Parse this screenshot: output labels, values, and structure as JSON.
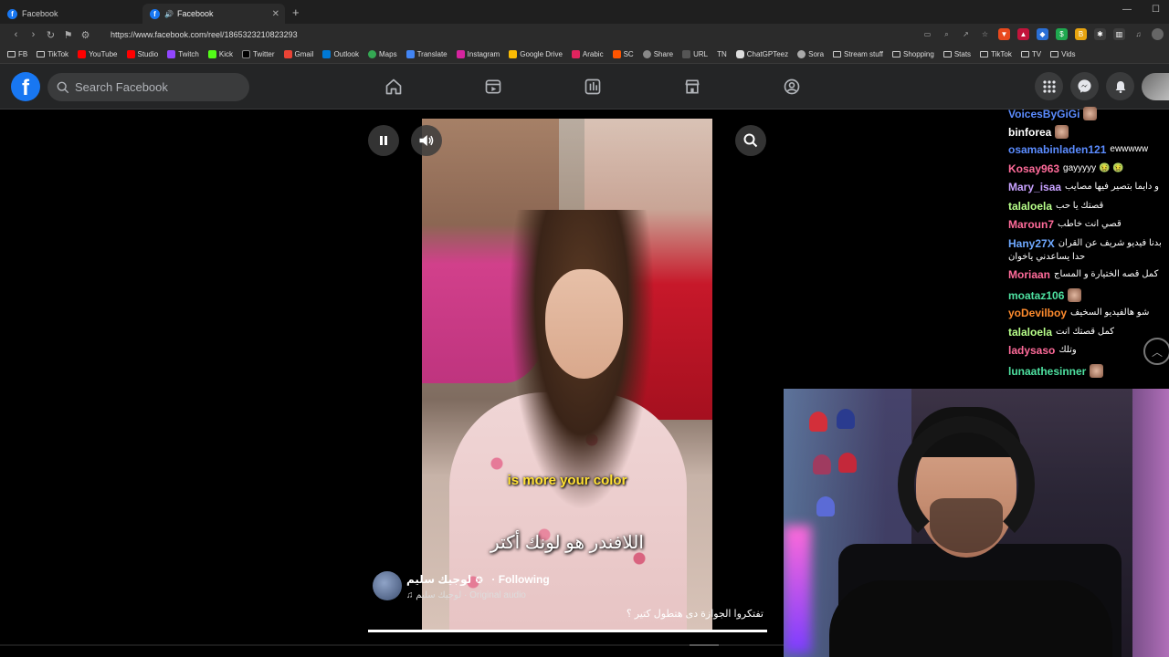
{
  "browser": {
    "tabs": [
      {
        "title": "Facebook",
        "active": false
      },
      {
        "title": "Facebook",
        "active": true
      }
    ],
    "url": "https://www.facebook.com/reel/1865323210823293",
    "bookmarks": [
      "FB",
      "TikTok",
      "YouTube",
      "Studio",
      "Twitch",
      "Kick",
      "Twitter",
      "Gmail",
      "Outlook",
      "Maps",
      "Translate",
      "Instagram",
      "Google Drive",
      "Arabic",
      "SC",
      "Share",
      "URL",
      "TN",
      "ChatGPTeez",
      "Sora",
      "Stream stuff",
      "Shopping",
      "Stats",
      "TikTok",
      "TV",
      "Vids"
    ]
  },
  "facebook": {
    "logo": "f",
    "search_placeholder": "Search Facebook"
  },
  "reel": {
    "subtitle_en": "is more your color",
    "subtitle_ar": "اللافندر هو لونك أكتر",
    "creator_name": "لوجيك سليم",
    "following_label": "· Following",
    "audio": "لوجيك سليم · Original audio",
    "caption": "تفتكروا الجوازة دى هتطول كتير ؟",
    "progress": 1.0
  },
  "chat": [
    {
      "user": "VoicesByGiGi",
      "color": "#5b8cff",
      "text": ""
    },
    {
      "user": "binforea",
      "color": "#ffffff",
      "text": ""
    },
    {
      "user": "osamabinladen121",
      "color": "#5b8cff",
      "text": "ewwwww"
    },
    {
      "user": "Kosay963",
      "color": "#ff6b9a",
      "text": "gayyyyy 🤢 🤢"
    },
    {
      "user": "Mary_isaa",
      "color": "#c8a2ff",
      "text": "و دايما بتصير فيها مصايب"
    },
    {
      "user": "talaloela",
      "color": "#b8ff8a",
      "text": "قصتك يا حب"
    },
    {
      "user": "Maroun7",
      "color": "#ff6b9a",
      "text": "قصي انت خاطب"
    },
    {
      "user": "Hany27X",
      "color": "#6ea8ff",
      "text": "بدنا فيديو شريف عن القران"
    },
    {
      "user": "",
      "color": "#ffffff",
      "text": "حدا يساعدني ياخوان"
    },
    {
      "user": "Moriaan",
      "color": "#ff6b9a",
      "text": "كمل قصه الختيارة و المساج"
    },
    {
      "user": "moataz106",
      "color": "#4ee0a0",
      "text": ""
    },
    {
      "user": "yoDevilboy",
      "color": "#ff8c2e",
      "text": "شو هالفيديو السخيف"
    },
    {
      "user": "talaloela",
      "color": "#b8ff8a",
      "text": "كمل قصتك انت"
    },
    {
      "user": "ladysaso",
      "color": "#ff6b9a",
      "text": "وتلك"
    },
    {
      "user": "lunaathesinner",
      "color": "#4ee0a0",
      "text": ""
    }
  ]
}
